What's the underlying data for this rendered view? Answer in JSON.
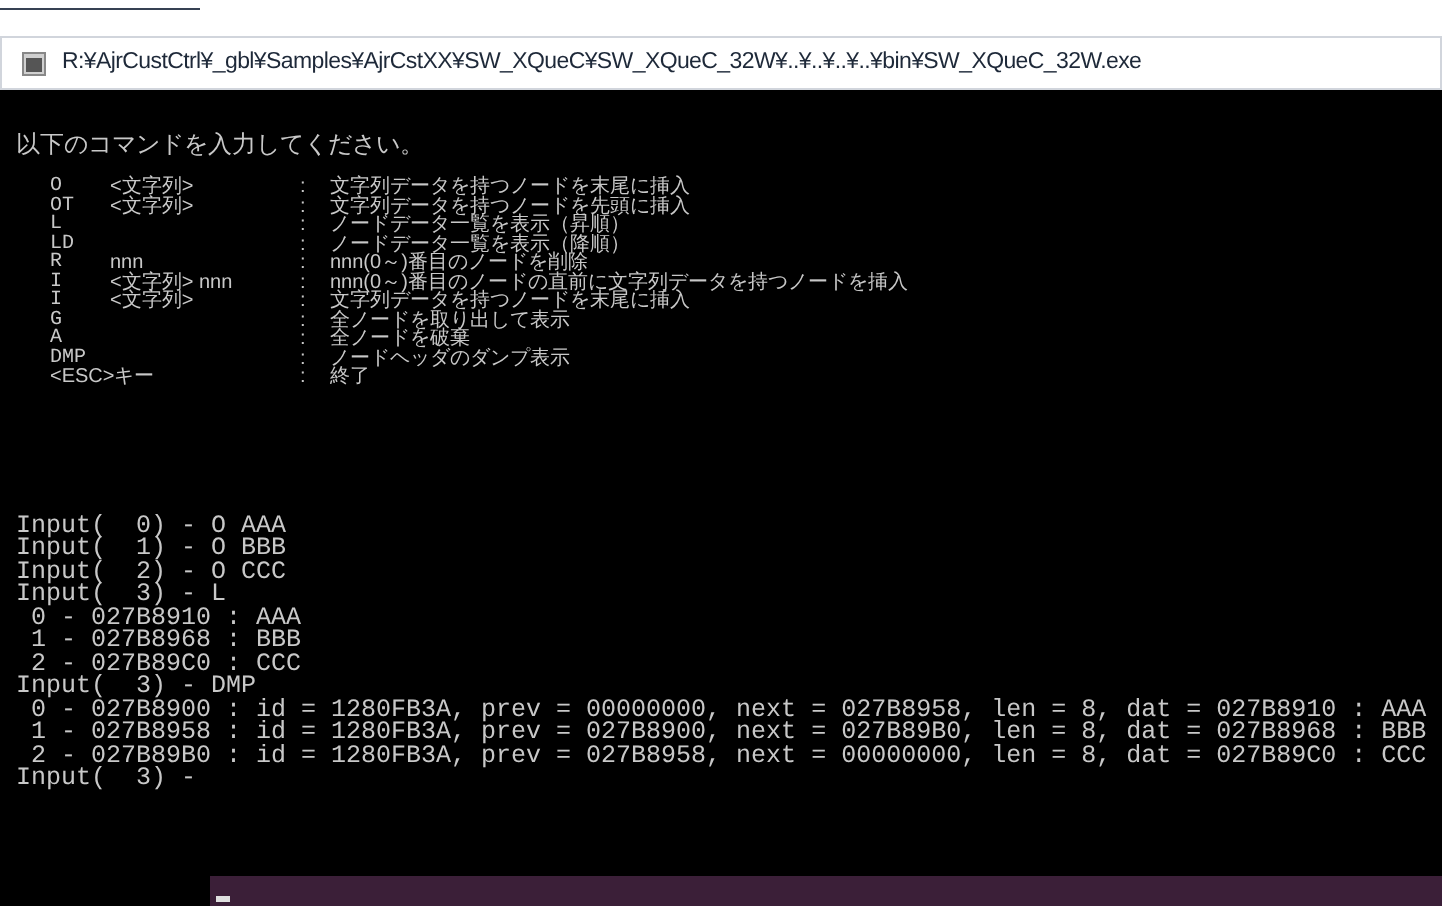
{
  "window": {
    "title": "R:¥AjrCustCtrl¥_gbl¥Samples¥AjrCstXX¥SW_XQueC¥SW_XQueC_32W¥..¥..¥..¥..¥bin¥SW_XQueC_32W.exe"
  },
  "console": {
    "message": "以下のコマンドを入力してください。",
    "commands": [
      {
        "key": "O",
        "arg": "<文字列>",
        "sep": ":",
        "description": "文字列データを持つノードを末尾に挿入"
      },
      {
        "key": "OT",
        "arg": "<文字列>",
        "sep": ":",
        "description": "文字列データを持つノードを先頭に挿入"
      },
      {
        "key": "L",
        "sep": ":",
        "description": "ノードデータ一覧を表示（昇順）"
      },
      {
        "key": "LD",
        "sep": ":",
        "description": "ノードデータ一覧を表示（降順）"
      },
      {
        "key": "R",
        "arg": "nnn",
        "sep": ":",
        "description": "nnn(0～)番目のノードを削除"
      },
      {
        "key": "I",
        "arg": "<文字列> nnn",
        "sep": ":",
        "description": "nnn(0～)番目のノードの直前に文字列データを持つノードを挿入"
      },
      {
        "key": "I",
        "arg": "<文字列>",
        "sep": ":",
        "description": "文字列データを持つノードを末尾に挿入"
      },
      {
        "key": "G",
        "sep": ":",
        "description": "全ノードを取り出して表示"
      },
      {
        "key": "A",
        "sep": ":",
        "description": "全ノードを破棄"
      },
      {
        "key": "DMP",
        "sep": ":",
        "description": "ノードヘッダのダンプ表示"
      },
      {
        "key": "<ESC>キー",
        "sep": ":",
        "description": "終了"
      }
    ],
    "output_lines": [
      "Input(  0) - O AAA",
      "Input(  1) - O BBB",
      "Input(  2) - O CCC",
      "Input(  3) - L",
      " 0 - 027B8910 : AAA",
      " 1 - 027B8968 : BBB",
      " 2 - 027B89C0 : CCC",
      "Input(  3) - DMP",
      " 0 - 027B8900 : id = 1280FB3A, prev = 00000000, next = 027B8958, len = 8, dat = 027B8910 : AAA",
      " 1 - 027B8958 : id = 1280FB3A, prev = 027B8900, next = 027B89B0, len = 8, dat = 027B8968 : BBB",
      " 2 - 027B89B0 : id = 1280FB3A, prev = 027B8958, next = 00000000, len = 8, dat = 027B89C0 : CCC"
    ],
    "prompt": "Input(  3) - "
  }
}
